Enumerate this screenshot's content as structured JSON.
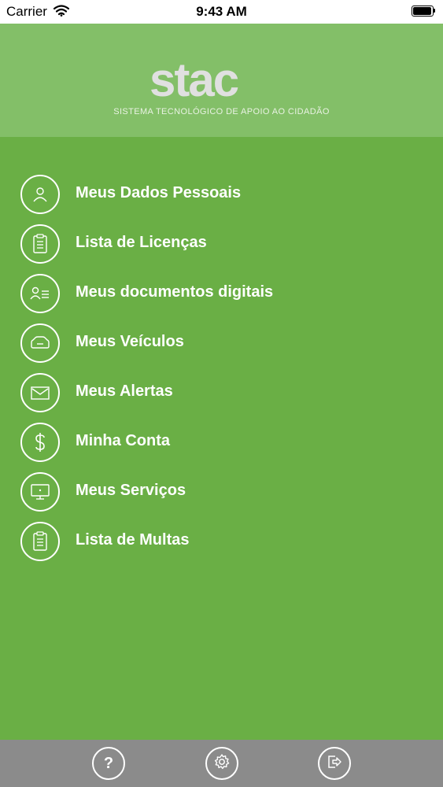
{
  "status_bar": {
    "carrier": "Carrier",
    "time": "9:43 AM",
    "battery_level": 1.0
  },
  "header": {
    "logo_text": "stac",
    "tagline": "SISTEMA TECNOLÓGICO DE APOIO AO CIDADÃO"
  },
  "menu": {
    "items": [
      {
        "label": "Meus Dados Pessoais",
        "icon": "person-icon"
      },
      {
        "label": "Lista de Licenças",
        "icon": "clipboard-icon"
      },
      {
        "label": "Meus documentos digitais",
        "icon": "id-card-icon"
      },
      {
        "label": "Meus Veículos",
        "icon": "car-icon"
      },
      {
        "label": "Meus Alertas",
        "icon": "envelope-icon"
      },
      {
        "label": "Minha Conta",
        "icon": "dollar-icon"
      },
      {
        "label": "Meus Serviços",
        "icon": "monitor-icon"
      },
      {
        "label": "Lista de Multas",
        "icon": "clipboard-icon"
      }
    ]
  },
  "tabbar": {
    "help_glyph": "?",
    "items": [
      "help-icon",
      "settings-icon",
      "logout-icon"
    ]
  },
  "colors": {
    "background": "#6aaf45",
    "header": "#83bf68",
    "tabbar": "#8b8b8b",
    "text": "#ffffff"
  }
}
